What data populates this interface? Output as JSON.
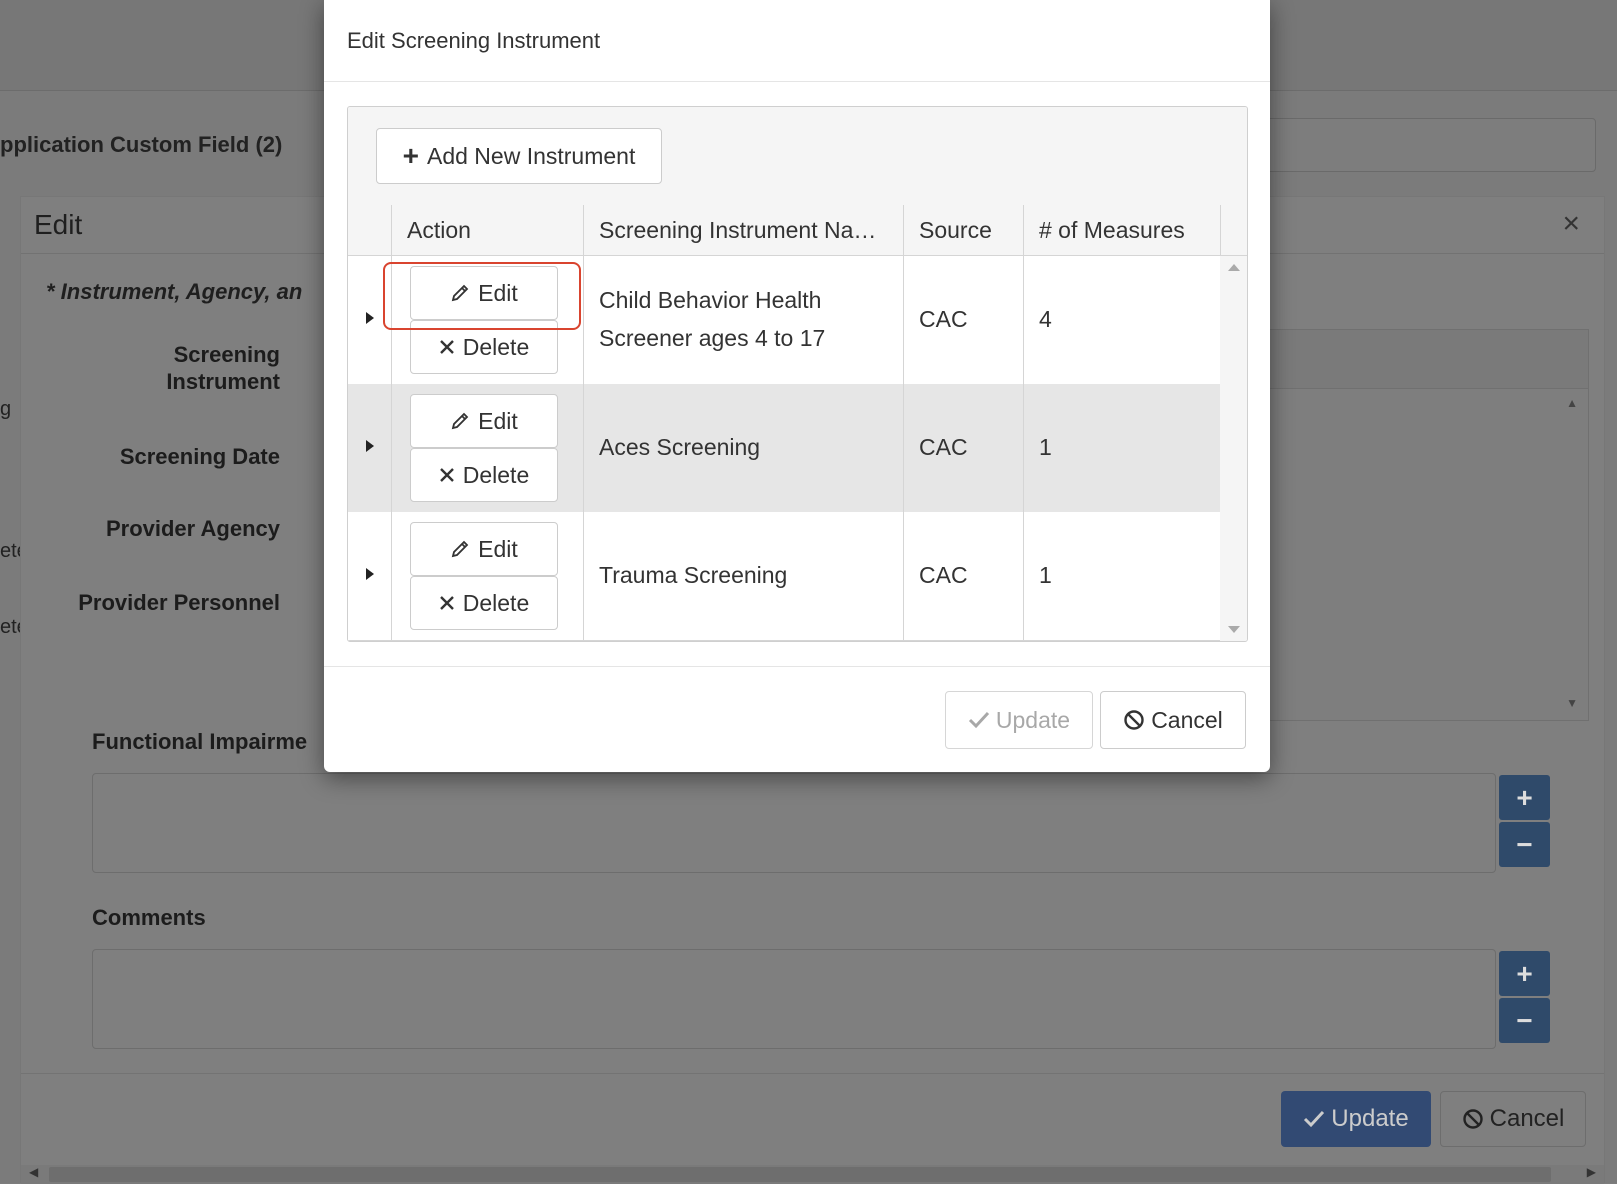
{
  "background": {
    "app_title": "pplication Custom Field (2)",
    "edge_fragments": [
      "g",
      "ete",
      "ete"
    ]
  },
  "edit_dialog": {
    "title": "Edit",
    "close_symbol": "×",
    "required_note": "* Instrument, Agency, an",
    "labels": {
      "screening_instrument_line1": "Screening",
      "screening_instrument_line2": "Instrument",
      "screening_date": "Screening Date",
      "provider_agency": "Provider Agency",
      "provider_personnel": "Provider Personnel",
      "functional_impairment": "Functional Impairme",
      "comments": "Comments"
    },
    "plus_symbol": "+",
    "minus_symbol": "−",
    "update_label": "Update",
    "cancel_label": "Cancel"
  },
  "modal": {
    "title": "Edit Screening Instrument",
    "add_button_label": "Add New Instrument",
    "columns": {
      "action": "Action",
      "name": "Screening Instrument Na…",
      "source": "Source",
      "measures": "# of Measures"
    },
    "rows": [
      {
        "name_line1": "Child Behavior Health",
        "name_line2": "Screener ages 4 to 17",
        "source": "CAC",
        "measures": "4",
        "edit_label": "Edit",
        "delete_label": "Delete"
      },
      {
        "name_line1": "Aces Screening",
        "name_line2": "",
        "source": "CAC",
        "measures": "1",
        "edit_label": "Edit",
        "delete_label": "Delete"
      },
      {
        "name_line1": "Trauma Screening",
        "name_line2": "",
        "source": "CAC",
        "measures": "1",
        "edit_label": "Edit",
        "delete_label": "Delete"
      }
    ],
    "update_label": "Update",
    "cancel_label": "Cancel"
  },
  "colors": {
    "primary_button": "#5b7fc9",
    "highlight_outline": "#d9442f",
    "overlay": "#7b7b7b"
  },
  "icons": [
    "pencil-icon",
    "x-icon",
    "plus-icon",
    "check-icon",
    "ban-icon",
    "caret-right-icon"
  ]
}
